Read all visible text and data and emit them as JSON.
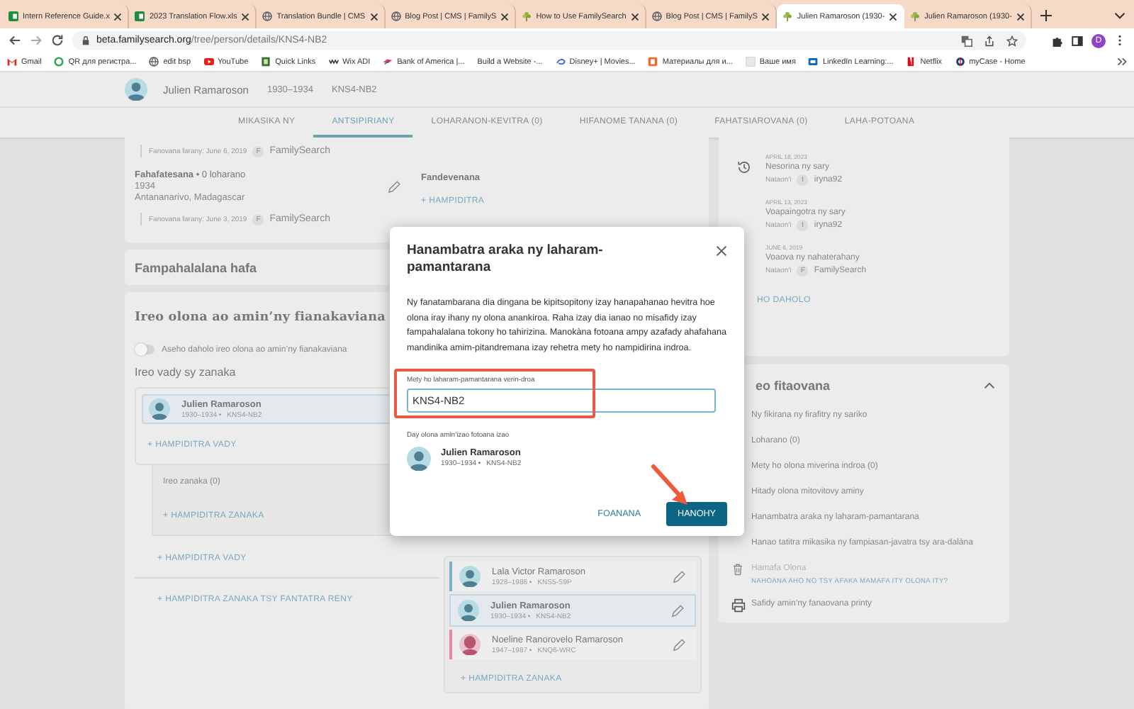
{
  "browser": {
    "tabs": [
      {
        "title": "Intern Reference Guide.x",
        "kind": "sheet",
        "selected": false
      },
      {
        "title": "2023 Translation Flow.xls",
        "kind": "sheet",
        "selected": false
      },
      {
        "title": "Translation Bundle | CMS",
        "kind": "globe",
        "selected": false
      },
      {
        "title": "Blog Post | CMS | FamilyS",
        "kind": "globe",
        "selected": false
      },
      {
        "title": "How to Use FamilySearch",
        "kind": "tree",
        "selected": false
      },
      {
        "title": "Blog Post | CMS | FamilyS",
        "kind": "globe",
        "selected": false
      },
      {
        "title": "Julien Ramaroson (1930-",
        "kind": "tree",
        "selected": true
      },
      {
        "title": "Julien Ramaroson (1930-",
        "kind": "tree",
        "selected": false
      }
    ],
    "url": {
      "host": "beta.familysearch.org",
      "path": "/tree/person/details/KNS4-NB2"
    },
    "profile_initial": "D",
    "bookmarks": [
      {
        "label": "Gmail",
        "kind": "mail"
      },
      {
        "label": "QR для регистра...",
        "kind": "ring"
      },
      {
        "label": "edit bsp",
        "kind": "globe"
      },
      {
        "label": "YouTube",
        "kind": "play"
      },
      {
        "label": "Quick Links",
        "kind": "book"
      },
      {
        "label": "Wix ADI",
        "kind": "bars"
      },
      {
        "label": "Bank of America |...",
        "kind": "flag"
      },
      {
        "label": "Build a Website -...",
        "kind": "none"
      },
      {
        "label": "Disney+ | Movies...",
        "kind": "swirl"
      },
      {
        "label": "Материалы для и...",
        "kind": "doc"
      },
      {
        "label": "Ваше имя",
        "kind": "blank"
      },
      {
        "label": "LinkedIn Learning:...",
        "kind": "card"
      },
      {
        "label": "Netflix",
        "kind": "stripe"
      },
      {
        "label": "myCase - Home",
        "kind": "round"
      }
    ]
  },
  "person": {
    "name": "Julien Ramaroson",
    "dates": "1930–1934",
    "pid": "KNS4-NB2"
  },
  "nav_tabs": [
    {
      "label": "MIKASIKA NY",
      "selected": false
    },
    {
      "label": "ANTSIPIRIANY",
      "selected": true
    },
    {
      "label": "LOHARANON-KEVITRA (0)",
      "selected": false
    },
    {
      "label": "HIFANOME TANANA (0)",
      "selected": false
    },
    {
      "label": "FAHATSIAROVANA (0)",
      "selected": false
    },
    {
      "label": "LAHA-POTOANA",
      "selected": false
    }
  ],
  "vitals": {
    "top_change": {
      "text": "Fanovana farany: June 6, 2019",
      "badge": "F",
      "by": "FamilySearch"
    },
    "death": {
      "title": "**Fahafatesana** • 0 loharano",
      "date": "1934",
      "place": "Antananarivo, Madagascar",
      "change": {
        "text": "Fanovana farany: June 3, 2019",
        "badge": "F",
        "by": "FamilySearch"
      }
    },
    "burial": {
      "title": "Fandevenana",
      "add": "+ HAMPIDITRA"
    }
  },
  "other_info": {
    "title": "Fampahalalana hafa"
  },
  "family": {
    "title": "Ireo olona ao amin’ny fianakaviana",
    "toggle": {
      "label": "Aseho daholo ireo olona ao amin’ny fianakaviana",
      "on": false
    },
    "spouses_heading": "Ireo vady sy zanaka",
    "couple": {
      "name": "Julien Ramaroson",
      "lifespan": "1930–1934 •",
      "pid": "KNS4-NB2",
      "kind": "male"
    },
    "add_spouse": "+ HAMPIDITRA VADY",
    "children": {
      "heading": "Ireo zanaka (0)",
      "add": "+ HAMPIDITRA ZANAKA"
    },
    "add_spouse_2": "+ HAMPIDITRA VADY",
    "add_child_unknown": "+ HAMPIDITRA ZANAKA TSY FANTATRA RENY",
    "parents_family": {
      "members": [
        {
          "name": "Lala Victor Ramaroson",
          "lifespan": "1928–1986 •",
          "pid": "KNS5-S9P",
          "kind": "male",
          "current": false
        },
        {
          "name": "Julien Ramaroson",
          "lifespan": "1930–1934 •",
          "pid": "KNS4-NB2",
          "kind": "male",
          "current": true
        },
        {
          "name": "Noeline Ranorovelo Ramaroson",
          "lifespan": "1947–1987 •",
          "pid": "KNQ6-WRC",
          "kind": "female",
          "current": false
        }
      ],
      "add": "+ HAMPIDITRA ZANAKA"
    }
  },
  "history": {
    "entries": [
      {
        "date": "APRIL 18, 2023",
        "action": "Nesorina ny sary",
        "by_label": "Nataon’i",
        "badge": "I",
        "user": "iryna92",
        "kind": "history"
      },
      {
        "date": "APRIL 13, 2023",
        "action": "Voapaingotra ny sary",
        "by_label": "Nataon’i",
        "badge": "I",
        "user": "iryna92",
        "kind": "none"
      },
      {
        "date": "JUNE 6, 2019",
        "action": "Voaova ny nahaterahany",
        "by_label": "Nataon’i",
        "badge": "F",
        "user": "FamilySearch",
        "kind": "none"
      }
    ],
    "show_all": "HO DAHOLO"
  },
  "tools": {
    "title": "eo fitaovana",
    "expanded": true,
    "items": [
      {
        "kind": "plain",
        "label": "Ny fikirana ny firafitry ny sariko",
        "disabled": false
      },
      {
        "kind": "plain",
        "label": "Loharano (0)",
        "disabled": false
      },
      {
        "kind": "plain",
        "label": "Mety ho olona miverina indroa (0)",
        "disabled": false
      },
      {
        "kind": "plain",
        "label": "Hitady olona mitovitovy aminy",
        "disabled": false
      },
      {
        "kind": "plain",
        "label": "Hanambatra araka ny laharam-pamantarana",
        "disabled": false
      },
      {
        "kind": "plain",
        "label": "Hanao tatitra mikasika ny fampiasan-javatra tsy ara-dalàna",
        "disabled": false
      },
      {
        "kind": "delete",
        "label": "Hamafa Olona",
        "disabled": true,
        "link": "NAHOANA AHO NO TSY AFAKA MAMAFA ITY OLONA ITY?"
      },
      {
        "kind": "print",
        "label": "Safidy amin’ny fanaovana printy",
        "disabled": false
      }
    ]
  },
  "modal": {
    "title": "Hanambatra araka ny laharam-pamantarana",
    "text": "Ny fanatambarana dia dingana be kipitsopitony izay hanapahanao hevitra hoe olona iray ihany ny olona anankiroa. Raha izay dia ianao no misafidy izay fampahalalana tokony ho tahirizina. Manokàna fotoana ampy azafady ahafahana mandinika amim-pitandremana izay rehetra mety ho nampidirina indroa.",
    "field": {
      "label": "Mety ho laharam-pamantarana verin-droa",
      "value": "KNS4-NB2"
    },
    "current_label": "Day olona amin’izao fotoana izao",
    "current": {
      "name": "Julien Ramaroson",
      "lifespan": "1930–1934 •",
      "pid": "KNS4-NB2",
      "kind": "male"
    },
    "buttons": [
      {
        "label": "FOANANA",
        "kind": "text"
      },
      {
        "label": "HANOHY",
        "kind": "primary"
      }
    ]
  }
}
